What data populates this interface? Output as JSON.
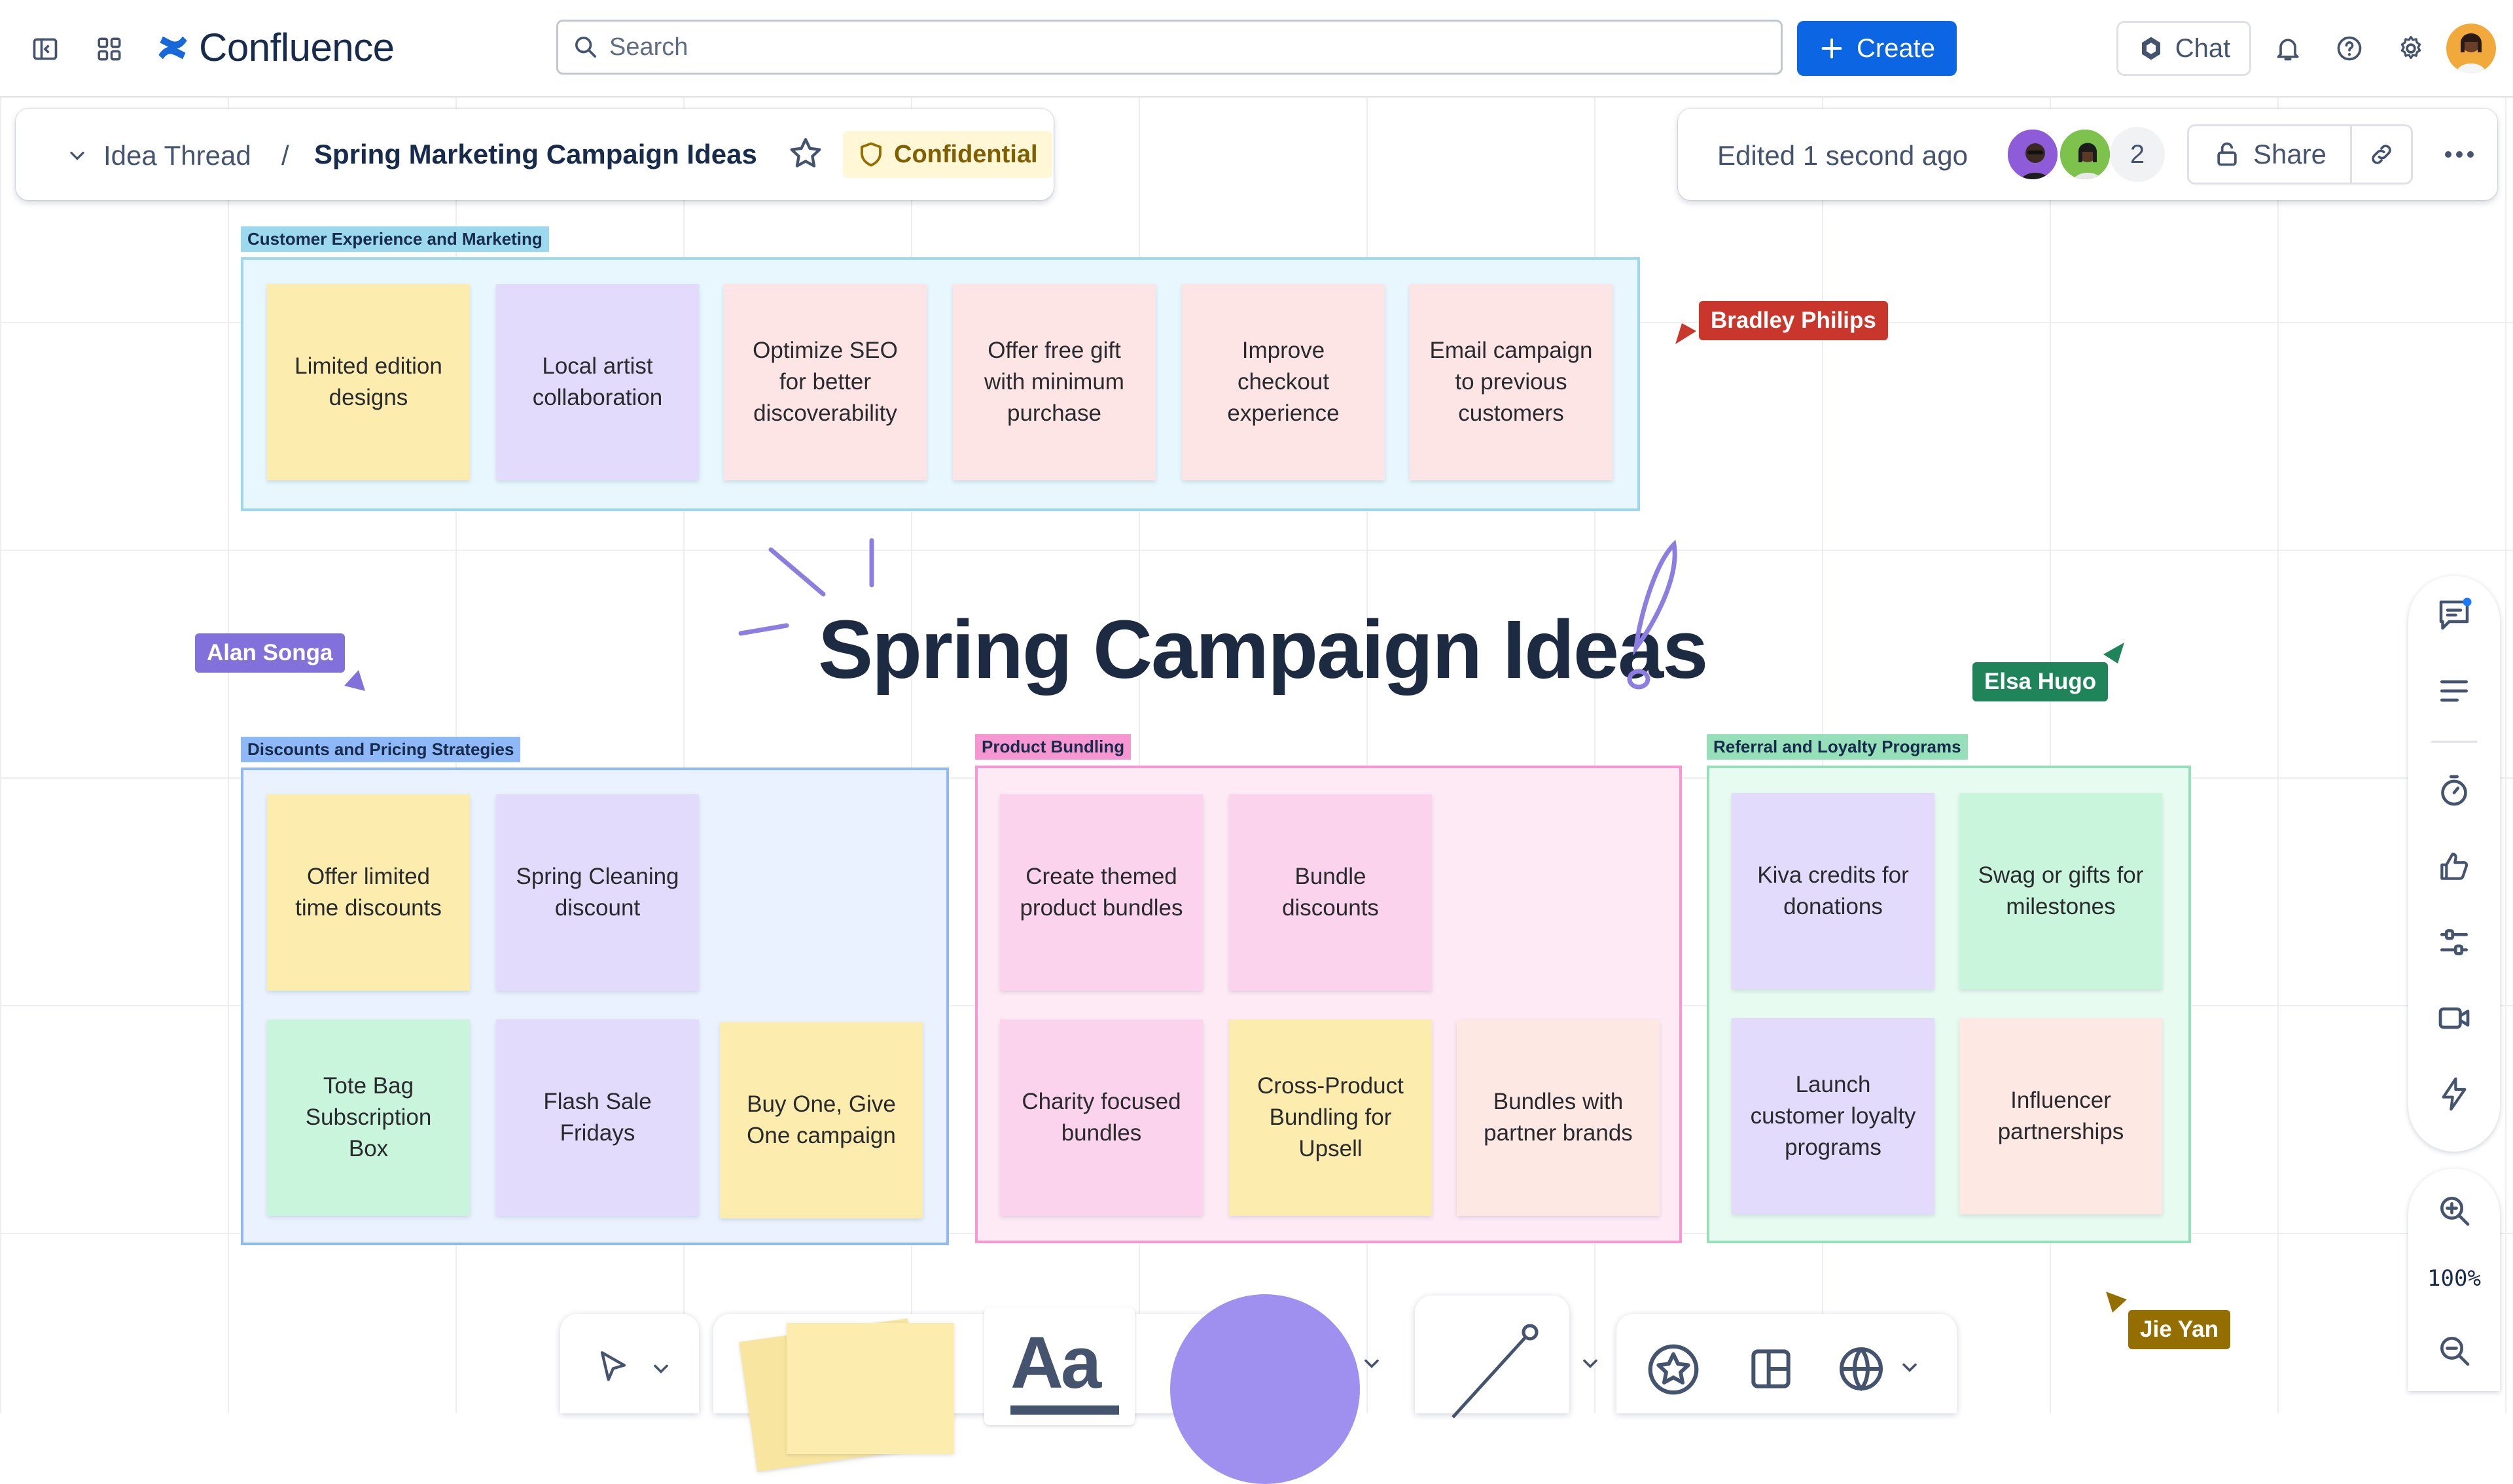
{
  "app": {
    "name": "Confluence",
    "search_placeholder": "Search",
    "create_label": "Create",
    "chat_label": "Chat",
    "accent": "#0c66e4"
  },
  "breadcrumb": {
    "space": "Idea Thread",
    "separator": "/",
    "title": "Spring Marketing Campaign Ideas",
    "classification": "Confidential"
  },
  "status": {
    "edited": "Edited 1 second ago",
    "viewer_count": "2",
    "share_label": "Share"
  },
  "board": {
    "title": "Spring Campaign Ideas",
    "sections": [
      {
        "label": "Customer Experience and Marketing",
        "notes": [
          "Limited edition designs",
          "Local artist collaboration",
          "Optimize SEO for better discoverability",
          "Offer free gift with minimum purchase",
          "Improve checkout experience",
          "Email campaign to previous customers"
        ]
      },
      {
        "label": "Discounts and Pricing Strategies",
        "notes": [
          "Offer limited time discounts",
          "Spring Cleaning discount",
          "Tote Bag Subscription Box",
          "Flash Sale Fridays",
          "Buy One, Give One campaign"
        ]
      },
      {
        "label": "Product Bundling",
        "notes": [
          "Create themed product bundles",
          "Bundle discounts",
          "Charity focused bundles",
          "Cross-Product Bundling for Upsell",
          "Bundles with partner brands"
        ]
      },
      {
        "label": "Referral and Loyalty Programs",
        "notes": [
          "Kiva credits for donations",
          "Swag or gifts for milestones",
          "Launch customer loyalty programs",
          "Influencer partnerships"
        ]
      }
    ]
  },
  "collaborators": [
    {
      "name": "Bradley Philips",
      "color": "#c9372c"
    },
    {
      "name": "Alan Songa",
      "color": "#8270db"
    },
    {
      "name": "Elsa Hugo",
      "color": "#1f845a"
    },
    {
      "name": "Jie Yan",
      "color": "#946f00"
    }
  ],
  "zoom": "100%",
  "toolbar_text_tool": "Aa"
}
